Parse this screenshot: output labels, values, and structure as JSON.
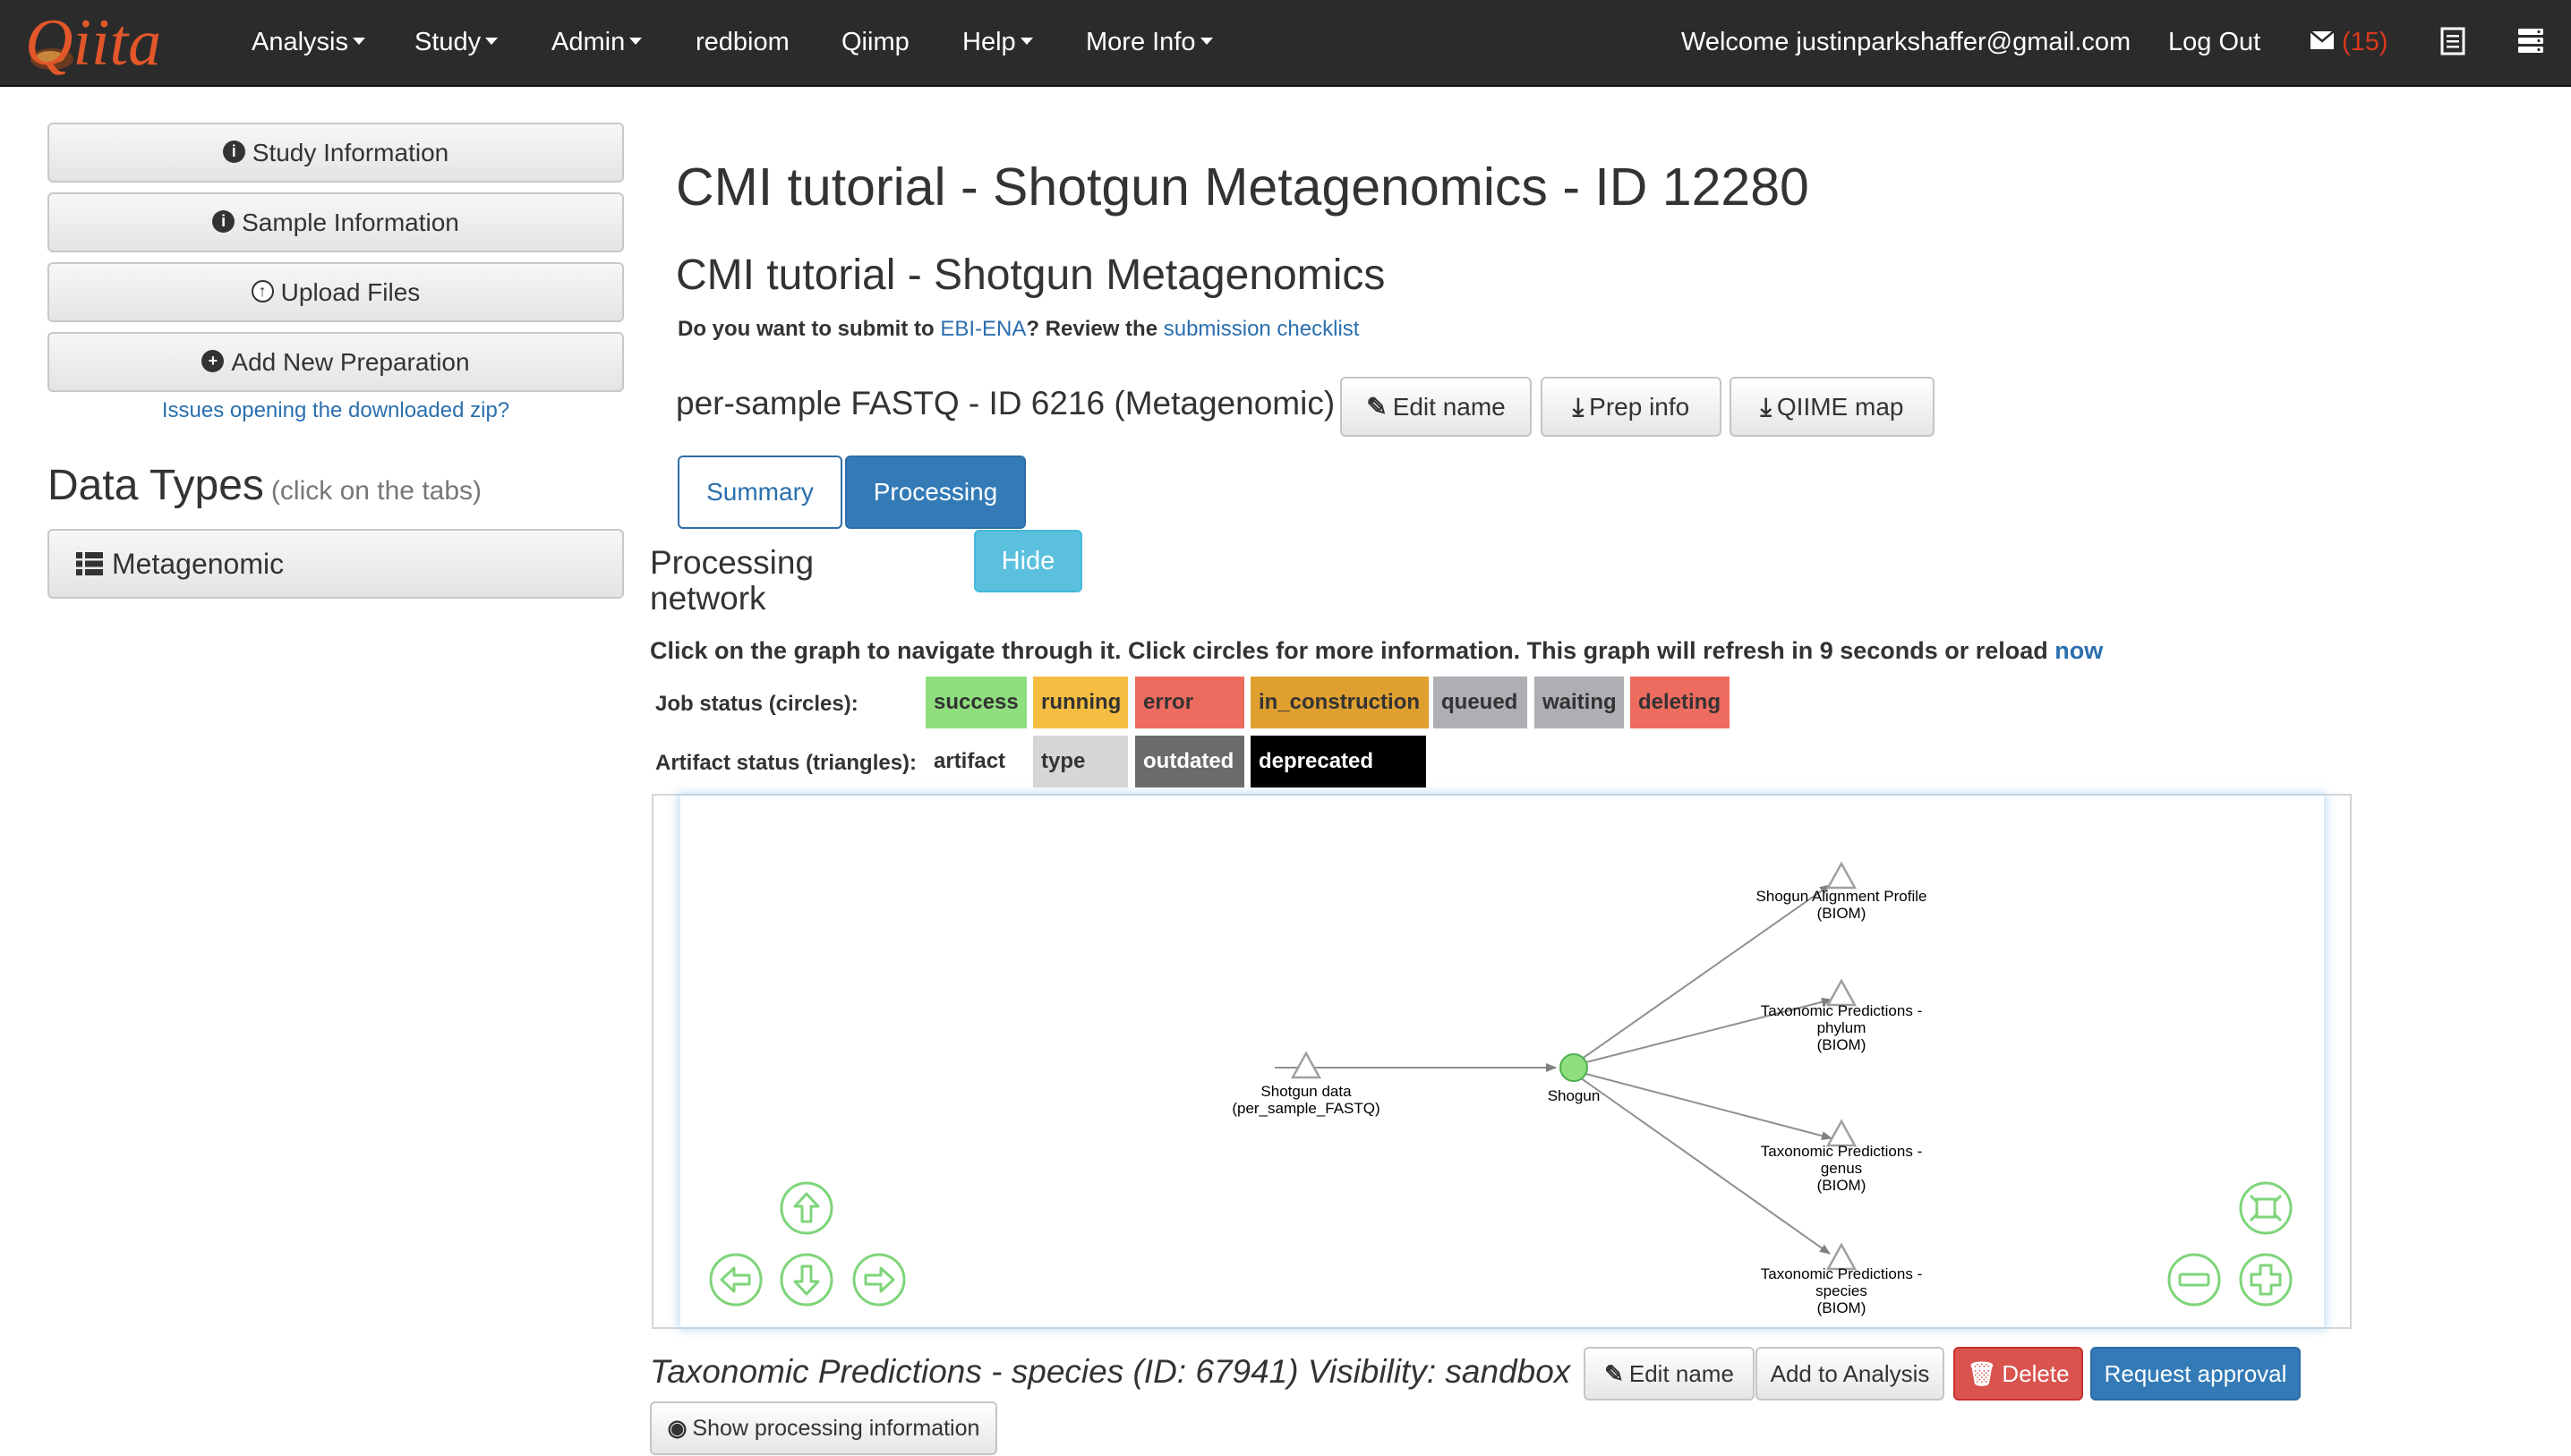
{
  "navbar": {
    "logo_text": "Qiita",
    "menu": {
      "analysis": "Analysis",
      "study": "Study",
      "admin": "Admin",
      "redbiom": "redbiom",
      "qiimp": "Qiimp",
      "help": "Help",
      "more_info": "More Info"
    },
    "welcome": "Welcome justinparkshaffer@gmail.com",
    "logout": "Log Out",
    "message_count": "(15)",
    "icons": [
      "envelope-icon",
      "list-icon",
      "server-icon"
    ],
    "bg_color": "#2b2b2b",
    "logo_color": "#e2572a"
  },
  "sidebar": {
    "study_information": "Study Information",
    "sample_information": "Sample Information",
    "upload_files": "Upload Files",
    "add_new_preparation": "Add New Preparation",
    "issues_link": "Issues opening the downloaded zip?",
    "data_types_title": "Data Types",
    "data_types_hint": "(click on the tabs)",
    "data_type_item": "Metagenomic"
  },
  "main": {
    "study_title": "CMI tutorial - Shotgun Metagenomics - ID 12280",
    "study_subtitle": "CMI tutorial - Shotgun Metagenomics",
    "ebi": {
      "prefix": "Do you want to submit to ",
      "ebi_link": "EBI-ENA",
      "middle": "? Review the ",
      "checklist_link": "submission checklist"
    },
    "prep_title": "per-sample FASTQ - ID 6216 (Metagenomic)",
    "prep_buttons": {
      "edit_name": "Edit name",
      "prep_info": "Prep info",
      "qiime_map": "QIIME map"
    },
    "tabs": {
      "summary": "Summary",
      "processing": "Processing"
    },
    "processing_title": "Processing network",
    "hide_button": "Hide",
    "graph_help": "Click on the graph to navigate through it. Click circles for more information. This graph will refresh in 9 seconds or reload ",
    "graph_help_link": "now",
    "job_status_label": "Job status (circles):",
    "job_statuses": {
      "success": "success",
      "running": "running",
      "error": "error",
      "in_construction": "in_construction",
      "queued": "queued",
      "waiting": "waiting",
      "deleting": "deleting"
    },
    "artifact_status_label": "Artifact status (triangles):",
    "artifact_statuses": {
      "artifact": "artifact",
      "type": "type",
      "outdated": "outdated",
      "deprecated": "deprecated"
    },
    "status_colors": {
      "success": "#8fdf7e",
      "running": "#f5be42",
      "error": "#ee6b5f",
      "in_construction": "#e0a030",
      "queued": "#aeaeb4",
      "waiting": "#aeaeb4",
      "deleting": "#ee6b5f",
      "type": "#d6d6d6",
      "outdated": "#6b6b6b",
      "deprecated": "#000000"
    },
    "graph": {
      "nodes": {
        "input_artifact": [
          "Shotgun data",
          "(per_sample_FASTQ)"
        ],
        "job": [
          "Shogun"
        ],
        "alignment_profile": [
          "Shogun Alignment Profile",
          "(BIOM)"
        ],
        "phylum": [
          "Taxonomic Predictions -",
          "phylum",
          "(BIOM)"
        ],
        "genus": [
          "Taxonomic Predictions -",
          "genus",
          "(BIOM)"
        ],
        "species": [
          "Taxonomic Predictions -",
          "species",
          "(BIOM)"
        ]
      },
      "controls": [
        "arrow-up-icon",
        "arrow-left-icon",
        "arrow-down-icon",
        "arrow-right-icon",
        "fit-screen-icon",
        "zoom-out-icon",
        "zoom-in-icon"
      ]
    },
    "artifact_title": "Taxonomic Predictions - species (ID: 67941) Visibility: sandbox",
    "artifact_buttons": {
      "edit_name": "Edit name",
      "add_to_analysis": "Add to Analysis",
      "delete": "Delete",
      "request_approval": "Request approval",
      "show_processing": "Show processing information"
    }
  }
}
